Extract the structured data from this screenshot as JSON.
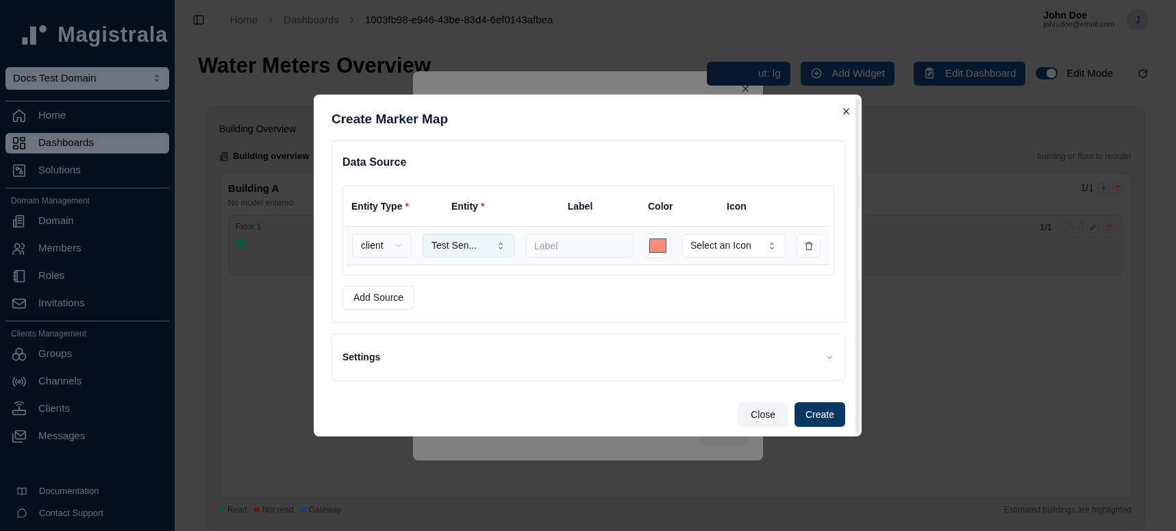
{
  "sidebar": {
    "logo": "Magistrala",
    "domain_select": "Docs Test Domain",
    "sections": [
      {
        "items": [
          {
            "label": "Home",
            "selected": false
          },
          {
            "label": "Dashboards",
            "selected": true
          },
          {
            "label": "Solutions",
            "selected": false
          }
        ]
      },
      {
        "heading": "Domain Management",
        "items": [
          {
            "label": "Domain",
            "selected": false
          },
          {
            "label": "Members",
            "selected": false
          },
          {
            "label": "Roles",
            "selected": false
          },
          {
            "label": "Invitations",
            "selected": false
          }
        ]
      },
      {
        "heading": "Clients Management",
        "items": [
          {
            "label": "Groups",
            "selected": false
          },
          {
            "label": "Channels",
            "selected": false
          },
          {
            "label": "Clients",
            "selected": false
          },
          {
            "label": "Messages",
            "selected": false
          }
        ]
      }
    ],
    "footer_links": [
      "Documentation",
      "Contact Support"
    ]
  },
  "header": {
    "breadcrumb": [
      "Home",
      "Dashboards",
      "1003fb98-e946-43be-83d4-6ef0143afbea"
    ],
    "user": {
      "name": "John Doe",
      "email": "john.doe@email.com",
      "avatar": "J"
    }
  },
  "page": {
    "title": "Water Meters Overview",
    "actions": [
      "ut: lg",
      "Add Widget",
      "Edit Dashboard"
    ],
    "edit_mode": {
      "label": "Edit Mode",
      "on": true
    }
  },
  "widget": {
    "title": "Building Overview",
    "subtitle": "Building overview",
    "hint": "building or floor to reorder",
    "buildings": [
      {
        "name": "Building A",
        "model": "No model entered",
        "count": "1/1",
        "floors": [
          {
            "name": "Floor 1",
            "count": "1/1",
            "meters": [
              {
                "color": "#0b5a3a"
              }
            ]
          }
        ]
      }
    ],
    "legend": [
      {
        "label": "Read",
        "color": "#0b5a3a"
      },
      {
        "label": "Not read",
        "color": "#6b1818"
      },
      {
        "label": "Gateway",
        "color": "#1c3a75"
      }
    ],
    "note": "Estimated buildings are highlighted"
  },
  "modal": {
    "title": "Create Marker Map",
    "data_source": {
      "title": "Data Source",
      "columns": [
        {
          "label": "Entity Type",
          "required_mark": "*"
        },
        {
          "label": "Entity",
          "required_mark": "*"
        },
        {
          "label": "Label"
        },
        {
          "label": "Color"
        },
        {
          "label": "Icon"
        }
      ],
      "rows": [
        {
          "entity_type": "client",
          "entity": "Test Sen...",
          "label_placeholder": "Label",
          "color": "#fa8e7b",
          "icon_placeholder": "Select an Icon"
        }
      ],
      "add_button": "Add Source"
    },
    "settings": {
      "title": "Settings",
      "expanded": false
    },
    "buttons": {
      "close": "Close",
      "create": "Create"
    }
  }
}
